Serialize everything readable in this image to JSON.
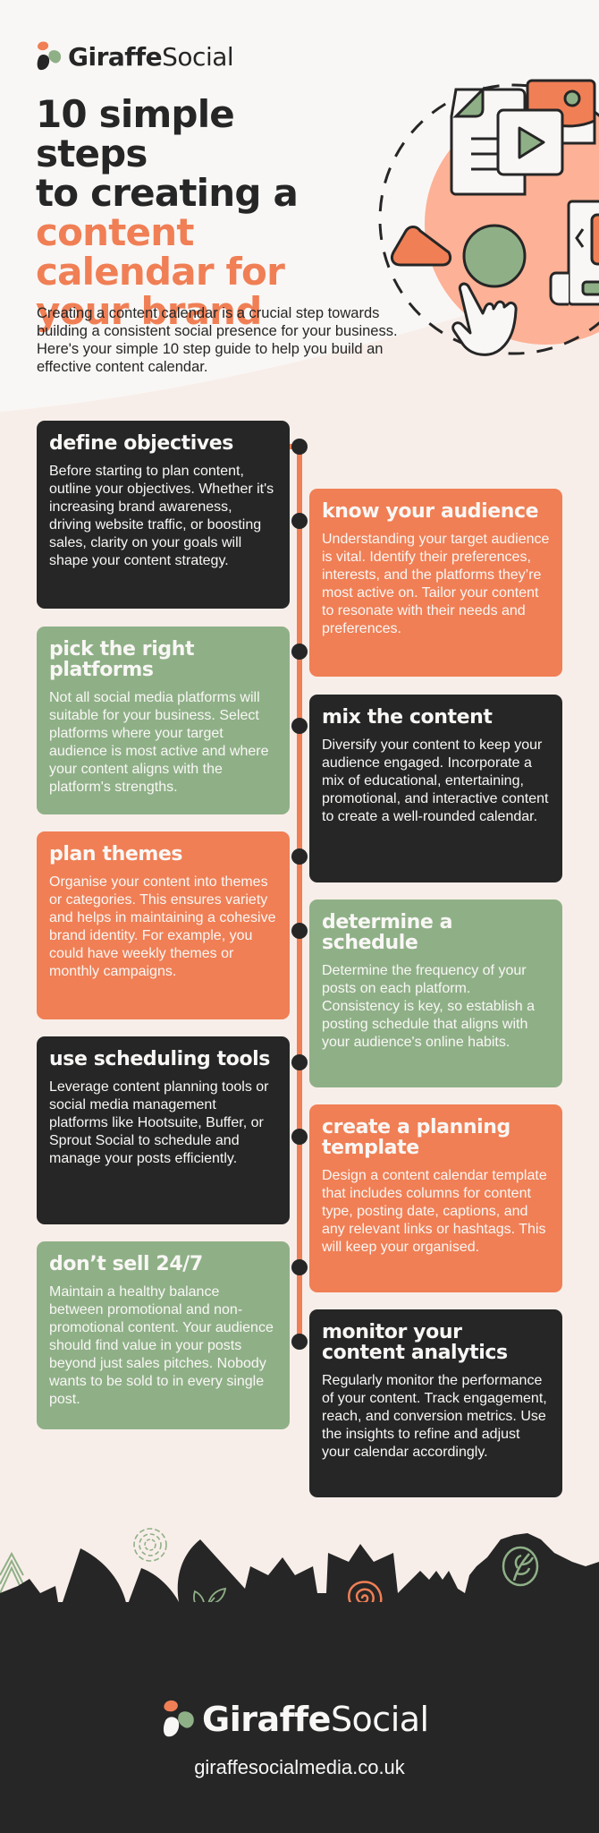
{
  "brand": {
    "name_bold": "Giraffe",
    "name_regular": "Social",
    "website": "giraffesocialmedia.co.uk"
  },
  "colors": {
    "dark": "#262626",
    "orange": "#f07f55",
    "green": "#8fb087",
    "peach": "#fdb196",
    "background": "#f9f7f5",
    "background_tint": "#f8eee9"
  },
  "hero": {
    "title_dark": [
      "10 simple steps",
      "to creating a"
    ],
    "title_accent": [
      "content",
      "calendar for",
      "your brand"
    ],
    "intro": "Creating a content calendar is a crucial step towards building a consistent social presence for your business. Here's your simple 10 step guide to help you build an effective content calendar.",
    "illustration_icons": [
      "document-icon",
      "video-play-icon",
      "image-icon",
      "triangle-shape-icon",
      "circle-shape-icon",
      "pointing-hand-icon",
      "media-carousel-icon"
    ]
  },
  "steps": [
    {
      "title": "define objectives",
      "body": "Before starting to plan content, outline your objectives. Whether it's increasing brand awareness, driving website traffic, or boosting sales, clarity on your goals will shape your content strategy.",
      "color": "dark",
      "side": "left"
    },
    {
      "title": "know your audience",
      "body": "Understanding your target audience is vital. Identify their preferences, interests, and the platforms they’re most active on. Tailor your content to resonate with their needs and preferences.",
      "color": "orange",
      "side": "right"
    },
    {
      "title": "pick the right platforms",
      "body": "Not all social media platforms will suitable for your business. Select platforms where your target audience is most active and where your content aligns with the platform's strengths.",
      "color": "green",
      "side": "left"
    },
    {
      "title": "mix the content",
      "body": "Diversify your content to keep your audience engaged. Incorporate a mix of educational, entertaining, promotional, and interactive content to create a well-rounded calendar.",
      "color": "dark",
      "side": "right"
    },
    {
      "title": "plan themes",
      "body": "Organise your content into themes or categories. This ensures variety and helps in maintaining a cohesive brand identity. For example, you could have weekly themes or monthly campaigns.",
      "color": "orange",
      "side": "left"
    },
    {
      "title": "determine a schedule",
      "body": "Determine the frequency of your posts on each platform. Consistency is key, so establish a posting schedule that aligns with your audience's online habits.",
      "color": "green",
      "side": "right"
    },
    {
      "title": "use scheduling tools",
      "body": "Leverage content planning tools or social media management platforms like Hootsuite, Buffer, or Sprout Social to schedule and manage your posts efficiently.",
      "color": "dark",
      "side": "left"
    },
    {
      "title": "create a planning template",
      "body": "Design a content calendar template that includes columns for content type, posting date, captions, and any relevant links or hashtags. This will keep your organised.",
      "color": "orange",
      "side": "right"
    },
    {
      "title": "don’t sell 24/7",
      "body": "Maintain a healthy balance between promotional and non-promotional content. Your audience should find value in your posts beyond just sales pitches. Nobody wants to be sold to in every single post.",
      "color": "green",
      "side": "left"
    },
    {
      "title": "monitor your content analytics",
      "body": "Regularly monitor the performance of your content. Track engagement, reach, and conversion metrics. Use the insights to refine and adjust your calendar accordingly.",
      "color": "dark",
      "side": "right"
    }
  ],
  "footer_decor_icons": [
    "zigzag-icon",
    "swirl-icon",
    "leaf-sprig-icon",
    "spiral-icon",
    "leaf-badge-icon"
  ]
}
